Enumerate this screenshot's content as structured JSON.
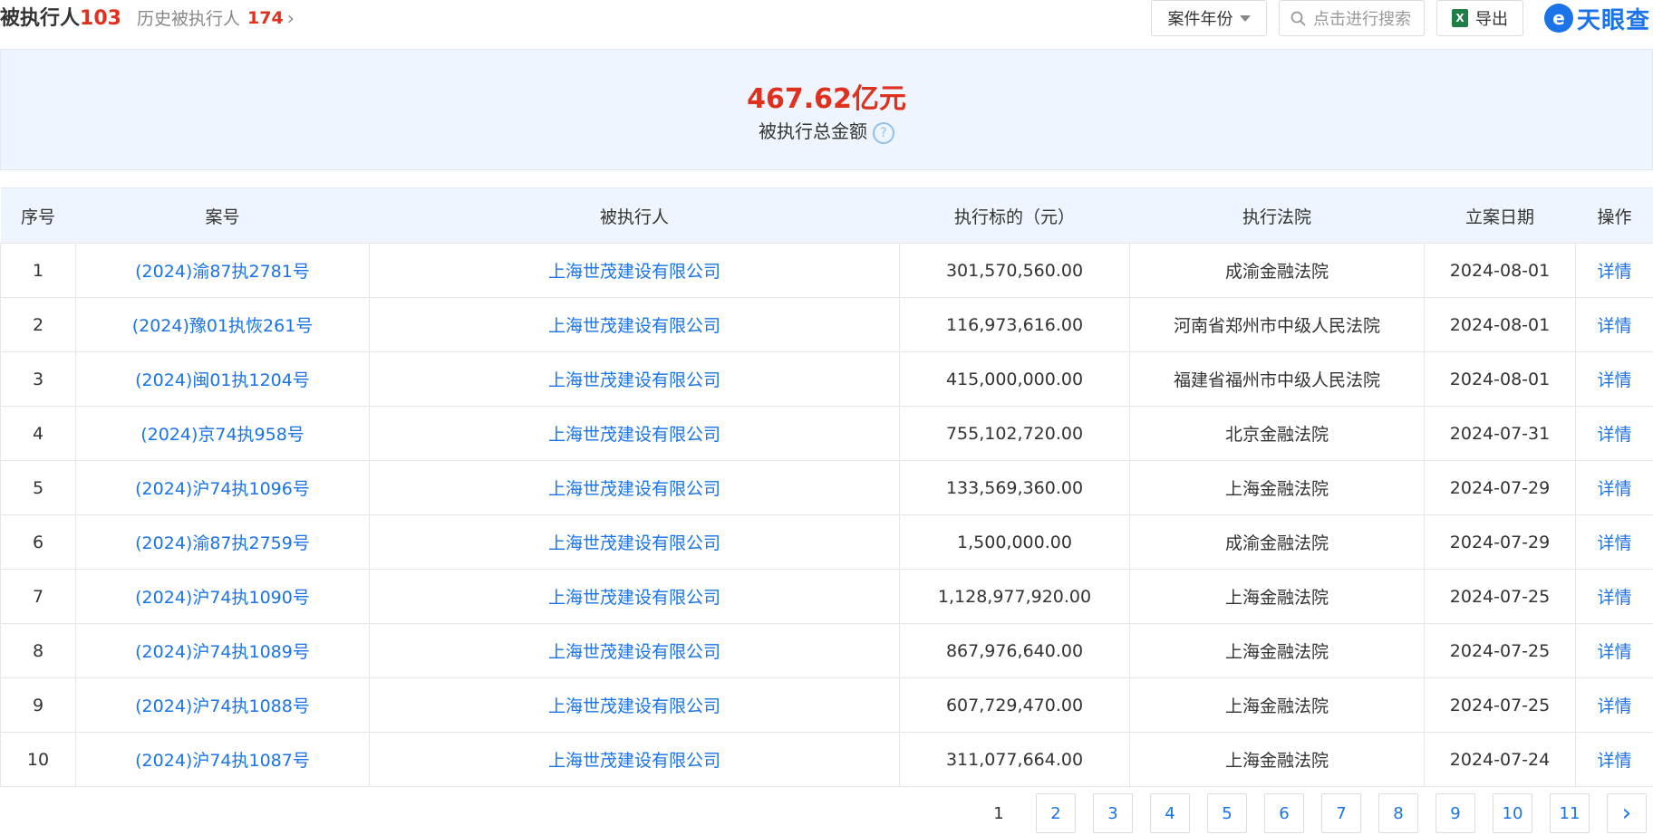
{
  "tabs": {
    "current_label": "被执行人",
    "current_count": "103",
    "history_label": "历史被执行人",
    "history_count": "174"
  },
  "toolbar": {
    "year_filter_label": "案件年份",
    "search_placeholder": "点击进行搜索",
    "export_label": "导出",
    "export_icon_text": "X"
  },
  "logo": {
    "mark": "e",
    "text": "天眼查"
  },
  "summary": {
    "amount": "467.62亿元",
    "label": "被执行总金额",
    "help_icon": "?"
  },
  "table": {
    "headers": [
      "序号",
      "案号",
      "被执行人",
      "执行标的（元）",
      "执行法院",
      "立案日期",
      "操作"
    ],
    "rows": [
      {
        "no": "1",
        "case": "(2024)渝87执2781号",
        "party": "上海世茂建设有限公司",
        "amount": "301,570,560.00",
        "court": "成渝金融法院",
        "date": "2024-08-01",
        "action": "详情"
      },
      {
        "no": "2",
        "case": "(2024)豫01执恢261号",
        "party": "上海世茂建设有限公司",
        "amount": "116,973,616.00",
        "court": "河南省郑州市中级人民法院",
        "date": "2024-08-01",
        "action": "详情"
      },
      {
        "no": "3",
        "case": "(2024)闽01执1204号",
        "party": "上海世茂建设有限公司",
        "amount": "415,000,000.00",
        "court": "福建省福州市中级人民法院",
        "date": "2024-08-01",
        "action": "详情"
      },
      {
        "no": "4",
        "case": "(2024)京74执958号",
        "party": "上海世茂建设有限公司",
        "amount": "755,102,720.00",
        "court": "北京金融法院",
        "date": "2024-07-31",
        "action": "详情"
      },
      {
        "no": "5",
        "case": "(2024)沪74执1096号",
        "party": "上海世茂建设有限公司",
        "amount": "133,569,360.00",
        "court": "上海金融法院",
        "date": "2024-07-29",
        "action": "详情"
      },
      {
        "no": "6",
        "case": "(2024)渝87执2759号",
        "party": "上海世茂建设有限公司",
        "amount": "1,500,000.00",
        "court": "成渝金融法院",
        "date": "2024-07-29",
        "action": "详情"
      },
      {
        "no": "7",
        "case": "(2024)沪74执1090号",
        "party": "上海世茂建设有限公司",
        "amount": "1,128,977,920.00",
        "court": "上海金融法院",
        "date": "2024-07-25",
        "action": "详情"
      },
      {
        "no": "8",
        "case": "(2024)沪74执1089号",
        "party": "上海世茂建设有限公司",
        "amount": "867,976,640.00",
        "court": "上海金融法院",
        "date": "2024-07-25",
        "action": "详情"
      },
      {
        "no": "9",
        "case": "(2024)沪74执1088号",
        "party": "上海世茂建设有限公司",
        "amount": "607,729,470.00",
        "court": "上海金融法院",
        "date": "2024-07-25",
        "action": "详情"
      },
      {
        "no": "10",
        "case": "(2024)沪74执1087号",
        "party": "上海世茂建设有限公司",
        "amount": "311,077,664.00",
        "court": "上海金融法院",
        "date": "2024-07-24",
        "action": "详情"
      }
    ]
  },
  "pagination": {
    "pages": [
      "1",
      "2",
      "3",
      "4",
      "5",
      "6",
      "7",
      "8",
      "9",
      "10",
      "11"
    ],
    "current": "1",
    "next_glyph": "›"
  },
  "icons": {
    "history_chevron": "›",
    "year_caret": "caret-down-icon",
    "search": "search-icon"
  }
}
